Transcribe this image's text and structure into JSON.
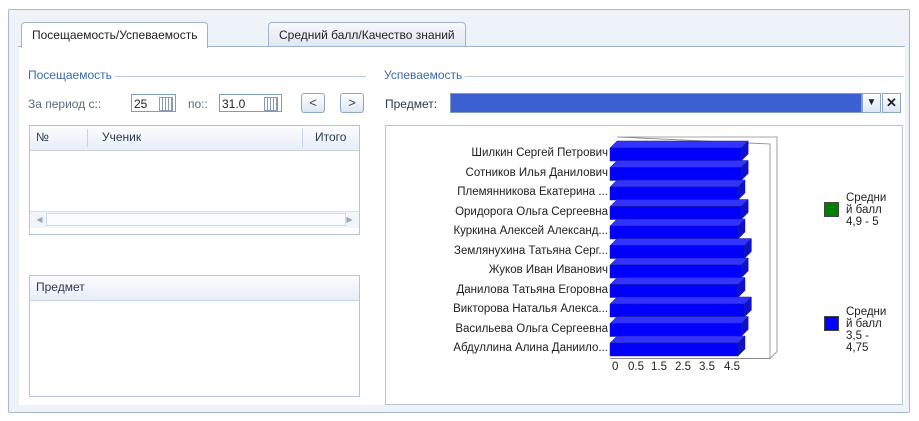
{
  "tabs": [
    {
      "label": "Посещаемость/Успеваемость",
      "active": true
    },
    {
      "label": "Средний балл/Качество знаний",
      "active": false
    }
  ],
  "attendance": {
    "group_title": "Посещаемость",
    "period_label": "За период с::",
    "period_from": "25",
    "period_to_label": "по::",
    "period_to": "31.0",
    "prev_label": "<",
    "next_label": ">",
    "table_headers": [
      "№",
      "Ученик",
      "Итого"
    ],
    "subject_header": "Предмет"
  },
  "performance": {
    "group_title": "Успеваемость",
    "subject_label": "Предмет:",
    "subject_value": "",
    "dropdown_icon": "triangle-down",
    "clear_icon": "cross"
  },
  "chart_data": {
    "type": "bar",
    "orientation": "horizontal",
    "categories": [
      "Шилкин Сергей Петрович",
      "Сотников Илья Данилович",
      "Племянникова Екатерина ...",
      "Оридорога Ольга Сергеевна",
      "Куркина Алексей Александ...",
      "Землянухина Татьяна Серг...",
      "Жуков Иван Иванович",
      "Данилова Татьяна Егоровна",
      "Викторова Наталья Алекса...",
      "Васильева Ольга Сергеевна",
      "Абдуллина Алина Даниило..."
    ],
    "x_ticks": [
      "0",
      "0.5",
      "1.5",
      "2.5",
      "3.5",
      "4.5"
    ],
    "xlim": [
      0,
      5
    ],
    "series": [
      {
        "name": "Средний балл 4,9 - 5",
        "color": "#008000",
        "values": [
          0,
          0,
          0,
          0,
          0,
          0,
          0,
          0,
          0,
          0,
          0
        ]
      },
      {
        "name": "Средний балл 3,5 - 4,75",
        "color": "#0000ff",
        "values": [
          4.1,
          4.1,
          4.0,
          4.1,
          4.0,
          4.2,
          4.1,
          4.0,
          4.2,
          4.1,
          4.0
        ]
      }
    ],
    "legend": [
      {
        "text": "Средни й балл 4,9 - 5",
        "color": "#008000"
      },
      {
        "text": "Средни й балл 3,5 - 4,75",
        "color": "#0000ff"
      }
    ],
    "legend_position": "right",
    "style": "3d"
  },
  "colors": {
    "accent": "#3b6ab2",
    "panel": "#eef3fa",
    "selection": "#3c5fd2"
  }
}
